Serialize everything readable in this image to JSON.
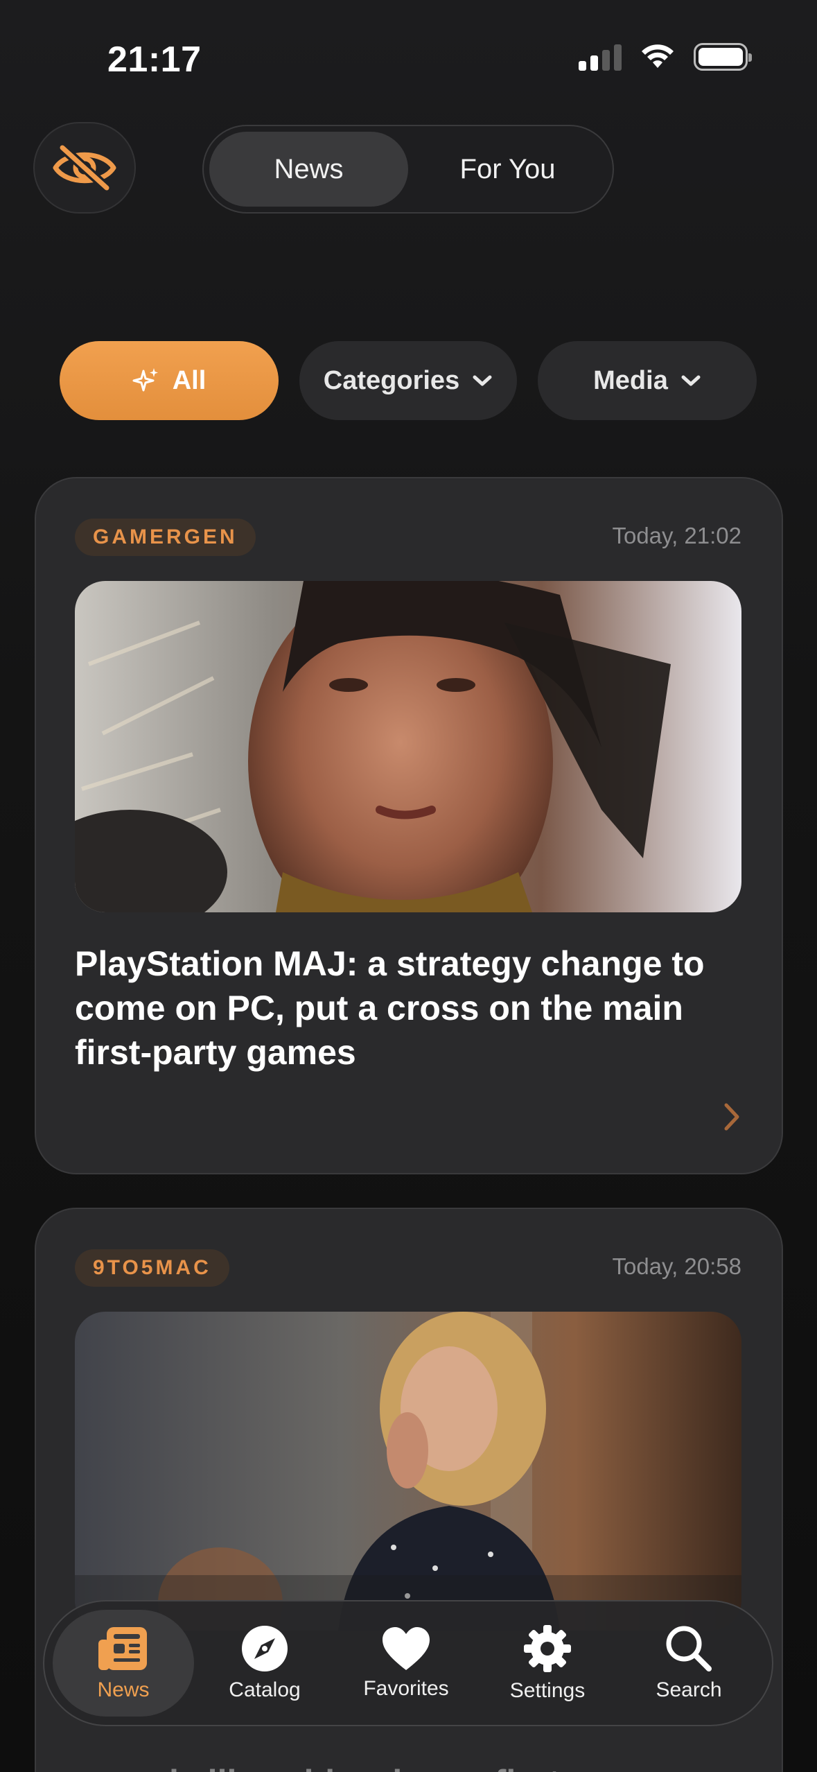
{
  "status_bar": {
    "time": "21:17"
  },
  "top_toggle": {
    "tabs": [
      "News",
      "For You"
    ],
    "active": "News"
  },
  "filters": {
    "all_label": "All",
    "categories_label": "Categories",
    "media_label": "Media"
  },
  "articles": [
    {
      "source": "GAMERGEN",
      "time": "Today, 21:02",
      "title": "PlayStation MAJ: a strategy change to come on PC, put a cross on the main first-party games"
    },
    {
      "source": "9TO5MAC",
      "time": "Today, 20:58",
      "title": "sounds like a big winner, first"
    }
  ],
  "tab_bar": {
    "items": [
      {
        "label": "News",
        "icon": "newspaper-icon",
        "active": true
      },
      {
        "label": "Catalog",
        "icon": "compass-icon",
        "active": false
      },
      {
        "label": "Favorites",
        "icon": "heart-icon",
        "active": false
      },
      {
        "label": "Settings",
        "icon": "gear-icon",
        "active": false
      },
      {
        "label": "Search",
        "icon": "search-icon",
        "active": false
      }
    ]
  },
  "colors": {
    "accent": "#f0a050",
    "background": "#121212",
    "card": "#2a2a2c"
  }
}
